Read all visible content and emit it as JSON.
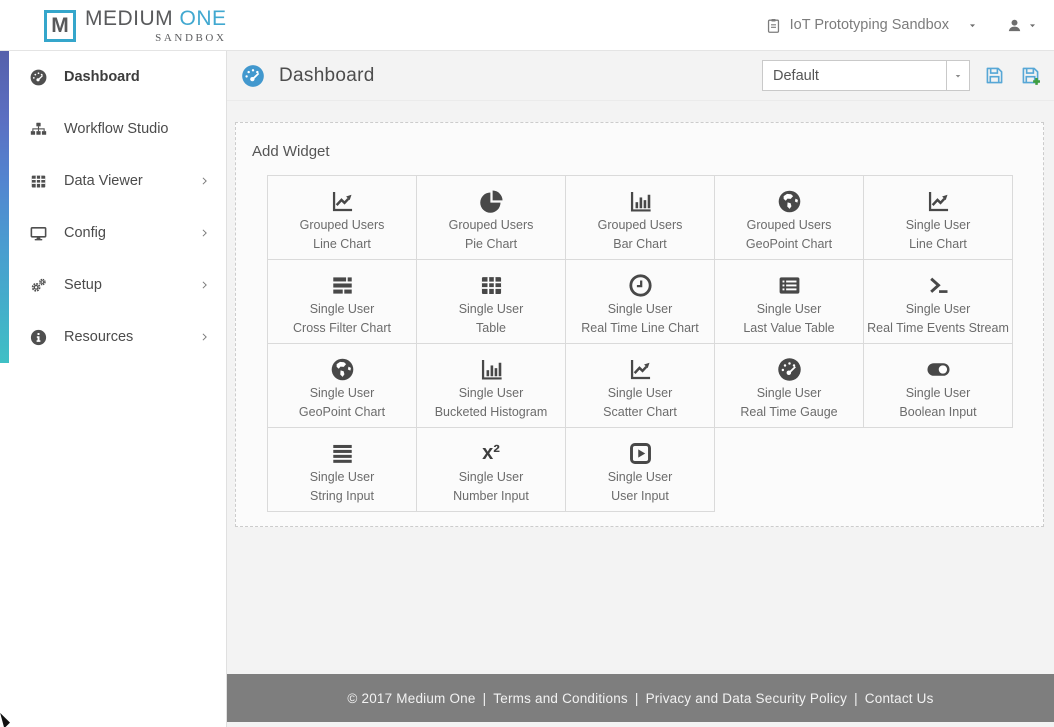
{
  "brand": {
    "logo_letter": "M",
    "name_primary": "MEDIUM ",
    "name_accent": "ONE",
    "subtitle": "SANDBOX"
  },
  "topbar": {
    "account_label": "IoT Prototyping Sandbox"
  },
  "sidebar": {
    "items": [
      {
        "label": "Dashboard",
        "icon": "gauge",
        "active": true,
        "has_submenu": false
      },
      {
        "label": "Workflow Studio",
        "icon": "sitemap",
        "active": false,
        "has_submenu": false
      },
      {
        "label": "Data Viewer",
        "icon": "table",
        "active": false,
        "has_submenu": true
      },
      {
        "label": "Config",
        "icon": "desktop",
        "active": false,
        "has_submenu": true
      },
      {
        "label": "Setup",
        "icon": "gears",
        "active": false,
        "has_submenu": true
      },
      {
        "label": "Resources",
        "icon": "info-circle",
        "active": false,
        "has_submenu": true
      }
    ]
  },
  "main_header": {
    "title": "Dashboard",
    "icon": "gauge",
    "layout_select_value": "Default",
    "actions": [
      {
        "name": "save-dashboard",
        "icon": "save-icon"
      },
      {
        "name": "save-dashboard-as-new",
        "icon": "save-plus-icon"
      }
    ]
  },
  "panel": {
    "title": "Add Widget",
    "widgets": [
      {
        "line1": "Grouped Users",
        "line2": "Line Chart",
        "icon": "line-chart"
      },
      {
        "line1": "Grouped Users",
        "line2": "Pie Chart",
        "icon": "pie-chart"
      },
      {
        "line1": "Grouped Users",
        "line2": "Bar Chart",
        "icon": "bar-chart"
      },
      {
        "line1": "Grouped Users",
        "line2": "GeoPoint Chart",
        "icon": "globe"
      },
      {
        "line1": "Single User",
        "line2": "Line Chart",
        "icon": "line-chart"
      },
      {
        "line1": "Single User",
        "line2": "Cross Filter Chart",
        "icon": "cross-filter"
      },
      {
        "line1": "Single User",
        "line2": "Table",
        "icon": "table"
      },
      {
        "line1": "Single User",
        "line2": "Real Time Line Chart",
        "icon": "clock"
      },
      {
        "line1": "Single User",
        "line2": "Last Value Table",
        "icon": "list-alt"
      },
      {
        "line1": "Single User",
        "line2": "Real Time Events Stream",
        "icon": "terminal"
      },
      {
        "line1": "Single User",
        "line2": "GeoPoint Chart",
        "icon": "globe"
      },
      {
        "line1": "Single User",
        "line2": "Bucketed Histogram",
        "icon": "bar-chart"
      },
      {
        "line1": "Single User",
        "line2": "Scatter Chart",
        "icon": "line-chart"
      },
      {
        "line1": "Single User",
        "line2": "Real Time Gauge",
        "icon": "gauge"
      },
      {
        "line1": "Single User",
        "line2": "Boolean Input",
        "icon": "toggle"
      },
      {
        "line1": "Single User",
        "line2": "String Input",
        "icon": "justify"
      },
      {
        "line1": "Single User",
        "line2": "Number Input",
        "icon": "x2",
        "glyph": "x²"
      },
      {
        "line1": "Single User",
        "line2": "User Input",
        "icon": "play-square"
      }
    ]
  },
  "footer": {
    "copyright": "© 2017 Medium One",
    "separator": "|",
    "links": [
      "Terms and Conditions",
      "Privacy and Data Security Policy",
      "Contact Us"
    ]
  },
  "colors": {
    "accent_blue": "#4298ce",
    "logo_cyan": "#41a8d0",
    "strip_top": "#5560ab",
    "strip_bottom": "#3fc0c5",
    "footer_bg": "#7e7e7e",
    "save_blue": "#57a7d6",
    "plus_green": "#3f9e3f"
  }
}
